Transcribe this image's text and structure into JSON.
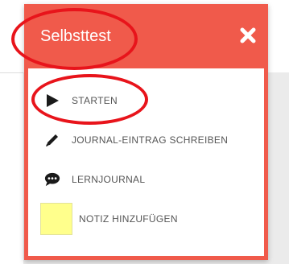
{
  "popup": {
    "title": "Selbsttest",
    "close_icon": "close-icon",
    "accent_color": "#f05a4b",
    "items": [
      {
        "icon": "play-icon",
        "label": "STARTEN"
      },
      {
        "icon": "pencil-icon",
        "label": "JOURNAL-EINTRAG SCHREIBEN"
      },
      {
        "icon": "speech-bubble-icon",
        "label": "LERNJOURNAL"
      },
      {
        "icon": "note-swatch",
        "label": "NOTIZ HINZUFÜGEN",
        "swatch_color": "#ffff8c"
      }
    ]
  },
  "annotations": {
    "color": "#e8141b"
  }
}
